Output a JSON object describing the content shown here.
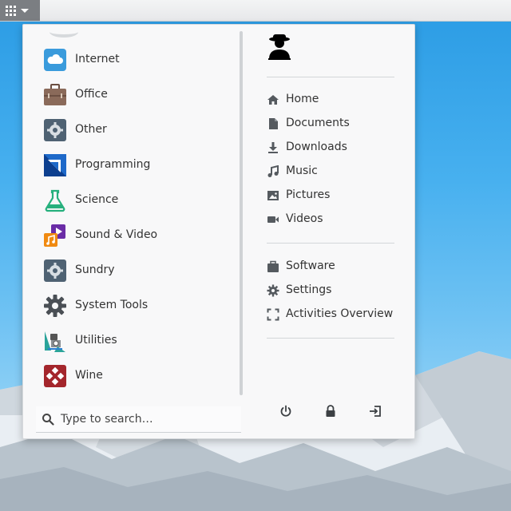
{
  "apps": [
    {
      "label": "Internet",
      "icon": "cloud-icon",
      "color": "#3a9bdc"
    },
    {
      "label": "Office",
      "icon": "briefcase-icon",
      "color": "#8a6a5a"
    },
    {
      "label": "Other",
      "icon": "gear-icon",
      "color": "#4f6273"
    },
    {
      "label": "Programming",
      "icon": "programming-icon",
      "color": "#1e69c9"
    },
    {
      "label": "Science",
      "icon": "flask-icon",
      "color": "#26b07d"
    },
    {
      "label": "Sound & Video",
      "icon": "sound-video-icon",
      "color": "#f08a12"
    },
    {
      "label": "Sundry",
      "icon": "gear-icon",
      "color": "#4f6273"
    },
    {
      "label": "System Tools",
      "icon": "cog-icon",
      "color": "#4a4f55"
    },
    {
      "label": "Utilities",
      "icon": "utilities-icon",
      "color": "#2aa39a"
    },
    {
      "label": "Wine",
      "icon": "wine-icon",
      "color": "#a4262c"
    }
  ],
  "search": {
    "placeholder": "Type to search…"
  },
  "places": [
    {
      "label": "Home",
      "icon": "home-icon"
    },
    {
      "label": "Documents",
      "icon": "document-icon"
    },
    {
      "label": "Downloads",
      "icon": "download-icon"
    },
    {
      "label": "Music",
      "icon": "music-icon"
    },
    {
      "label": "Pictures",
      "icon": "picture-icon"
    },
    {
      "label": "Videos",
      "icon": "video-icon"
    }
  ],
  "system": [
    {
      "label": "Software",
      "icon": "software-icon"
    },
    {
      "label": "Settings",
      "icon": "settings-icon"
    },
    {
      "label": "Activities Overview",
      "icon": "activities-icon"
    }
  ],
  "colors": {
    "panel_button": "#7b7e82",
    "icon_gray": "#555a5f",
    "menu_bg": "#f8f8f9"
  }
}
